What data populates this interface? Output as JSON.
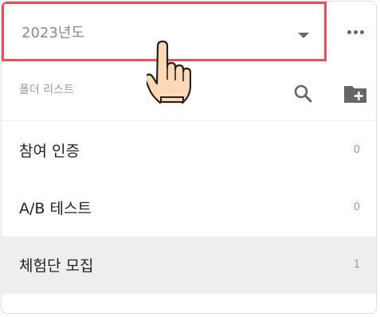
{
  "header": {
    "year_select_value": "2023년도"
  },
  "toolbar": {
    "label": "폴더 리스트"
  },
  "folders": [
    {
      "label": "참여 인증",
      "count": "0",
      "selected": false
    },
    {
      "label": "A/B 테스트",
      "count": "0",
      "selected": false
    },
    {
      "label": "체험단 모집",
      "count": "1",
      "selected": true
    }
  ],
  "icons": {
    "caret": "caret-down-icon",
    "more": "more-horizontal-icon",
    "search": "search-icon",
    "add_folder": "folder-add-icon",
    "pointer": "pointing-hand-icon"
  },
  "colors": {
    "highlight_border": "#e5505a",
    "selected_row": "#eeeeee"
  }
}
